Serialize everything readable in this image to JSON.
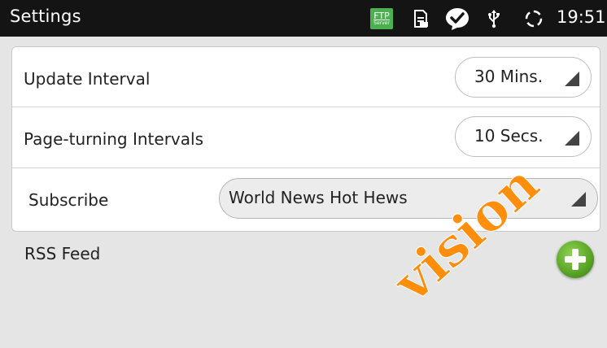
{
  "status_bar": {
    "title": "Settings",
    "ftp_line1": "FTP",
    "ftp_line2": "Server",
    "time": "19:51",
    "icons": [
      "ftp-server-icon",
      "sim-card-icon",
      "check-bubble-icon",
      "usb-icon",
      "sync-icon"
    ]
  },
  "settings": {
    "update_interval": {
      "label": "Update Interval",
      "value": "30 Mins."
    },
    "page_turning_intervals": {
      "label": "Page-turning Intervals",
      "value": "10 Secs."
    },
    "subscribe": {
      "label": "Subscribe",
      "value": "World News Hot Hews"
    }
  },
  "rss": {
    "label": "RSS Feed"
  },
  "watermark": "vision",
  "colors": {
    "accent_green": "#4caf50",
    "watermark_orange": "#ff8a00",
    "status_bar": "#141414"
  }
}
